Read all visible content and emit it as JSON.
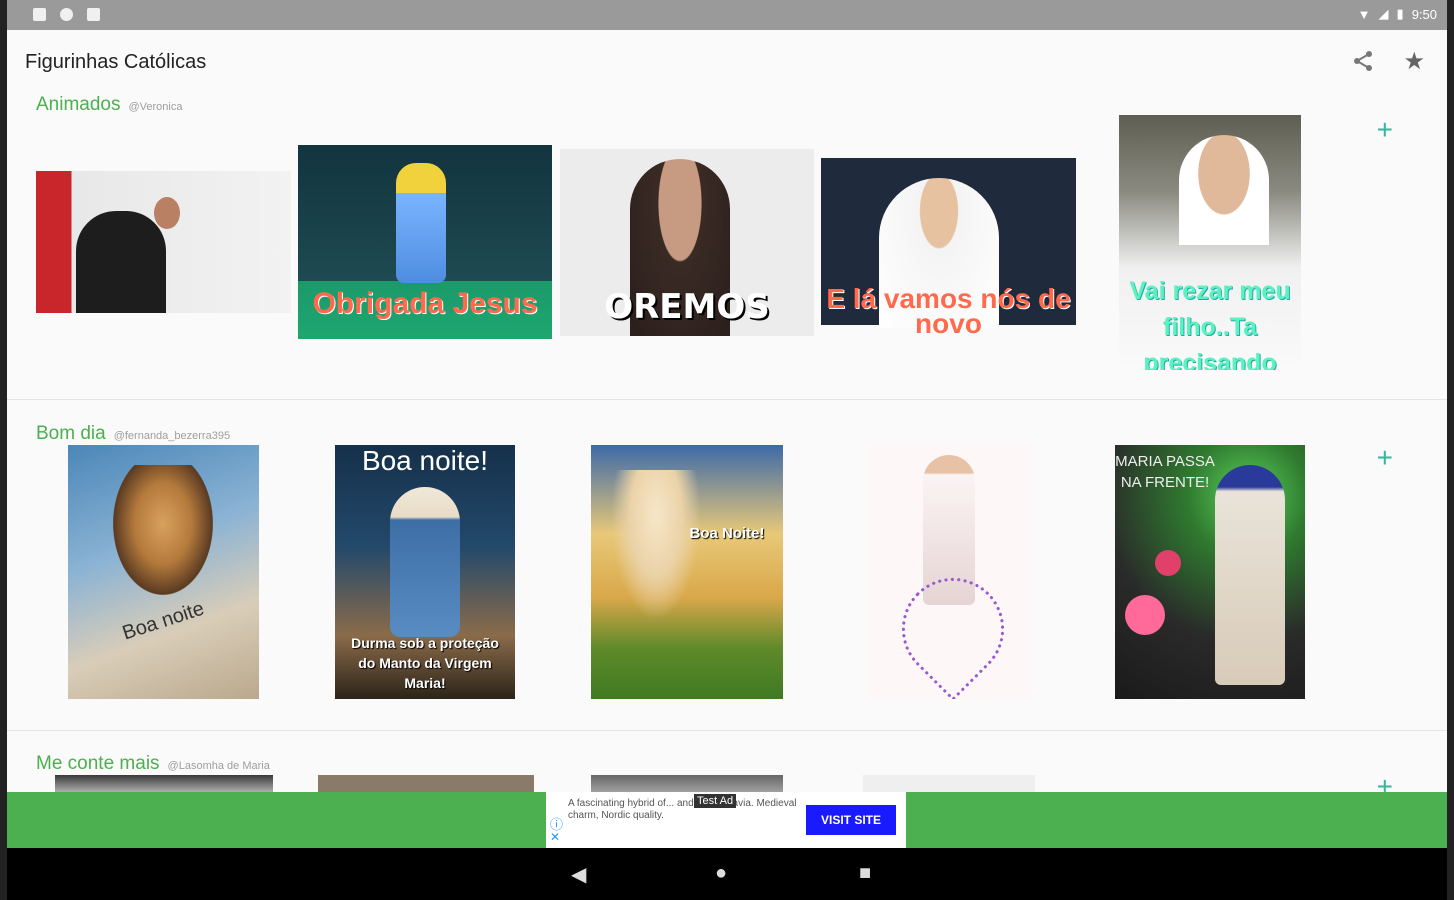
{
  "status": {
    "time": "9:50"
  },
  "app": {
    "title": "Figurinhas Católicas"
  },
  "sections": [
    {
      "name": "Animados",
      "author": "@Veronica",
      "add": "+",
      "stickers": [
        {
          "caption": ""
        },
        {
          "caption": "Obrigada Jesus"
        },
        {
          "caption": "OREMOS"
        },
        {
          "caption": "E lá vamos nós de novo"
        },
        {
          "caption": "Vai rezar meu filho..Ta precisando"
        }
      ]
    },
    {
      "name": "Bom dia",
      "author": "@fernanda_bezerra395",
      "add": "+",
      "stickers": [
        {
          "caption": "Boa noite"
        },
        {
          "caption": "Boa noite!",
          "caption2": "Durma sob a proteção do Manto da Virgem Maria!"
        },
        {
          "caption": "Boa Noite!"
        },
        {
          "caption": ""
        },
        {
          "caption": "MARIA PASSA NA FRENTE!"
        }
      ]
    },
    {
      "name": "Me conte mais",
      "author": "@Lasomha de Maria",
      "add": "+"
    }
  ],
  "ad": {
    "text": "A fascinating hybrid of... and Scandinavia. Medieval charm, Nordic quality.",
    "tag": "Test Ad",
    "button": "VISIT SITE"
  },
  "nav": {
    "back": "◀",
    "home": "●",
    "recents": "■"
  }
}
